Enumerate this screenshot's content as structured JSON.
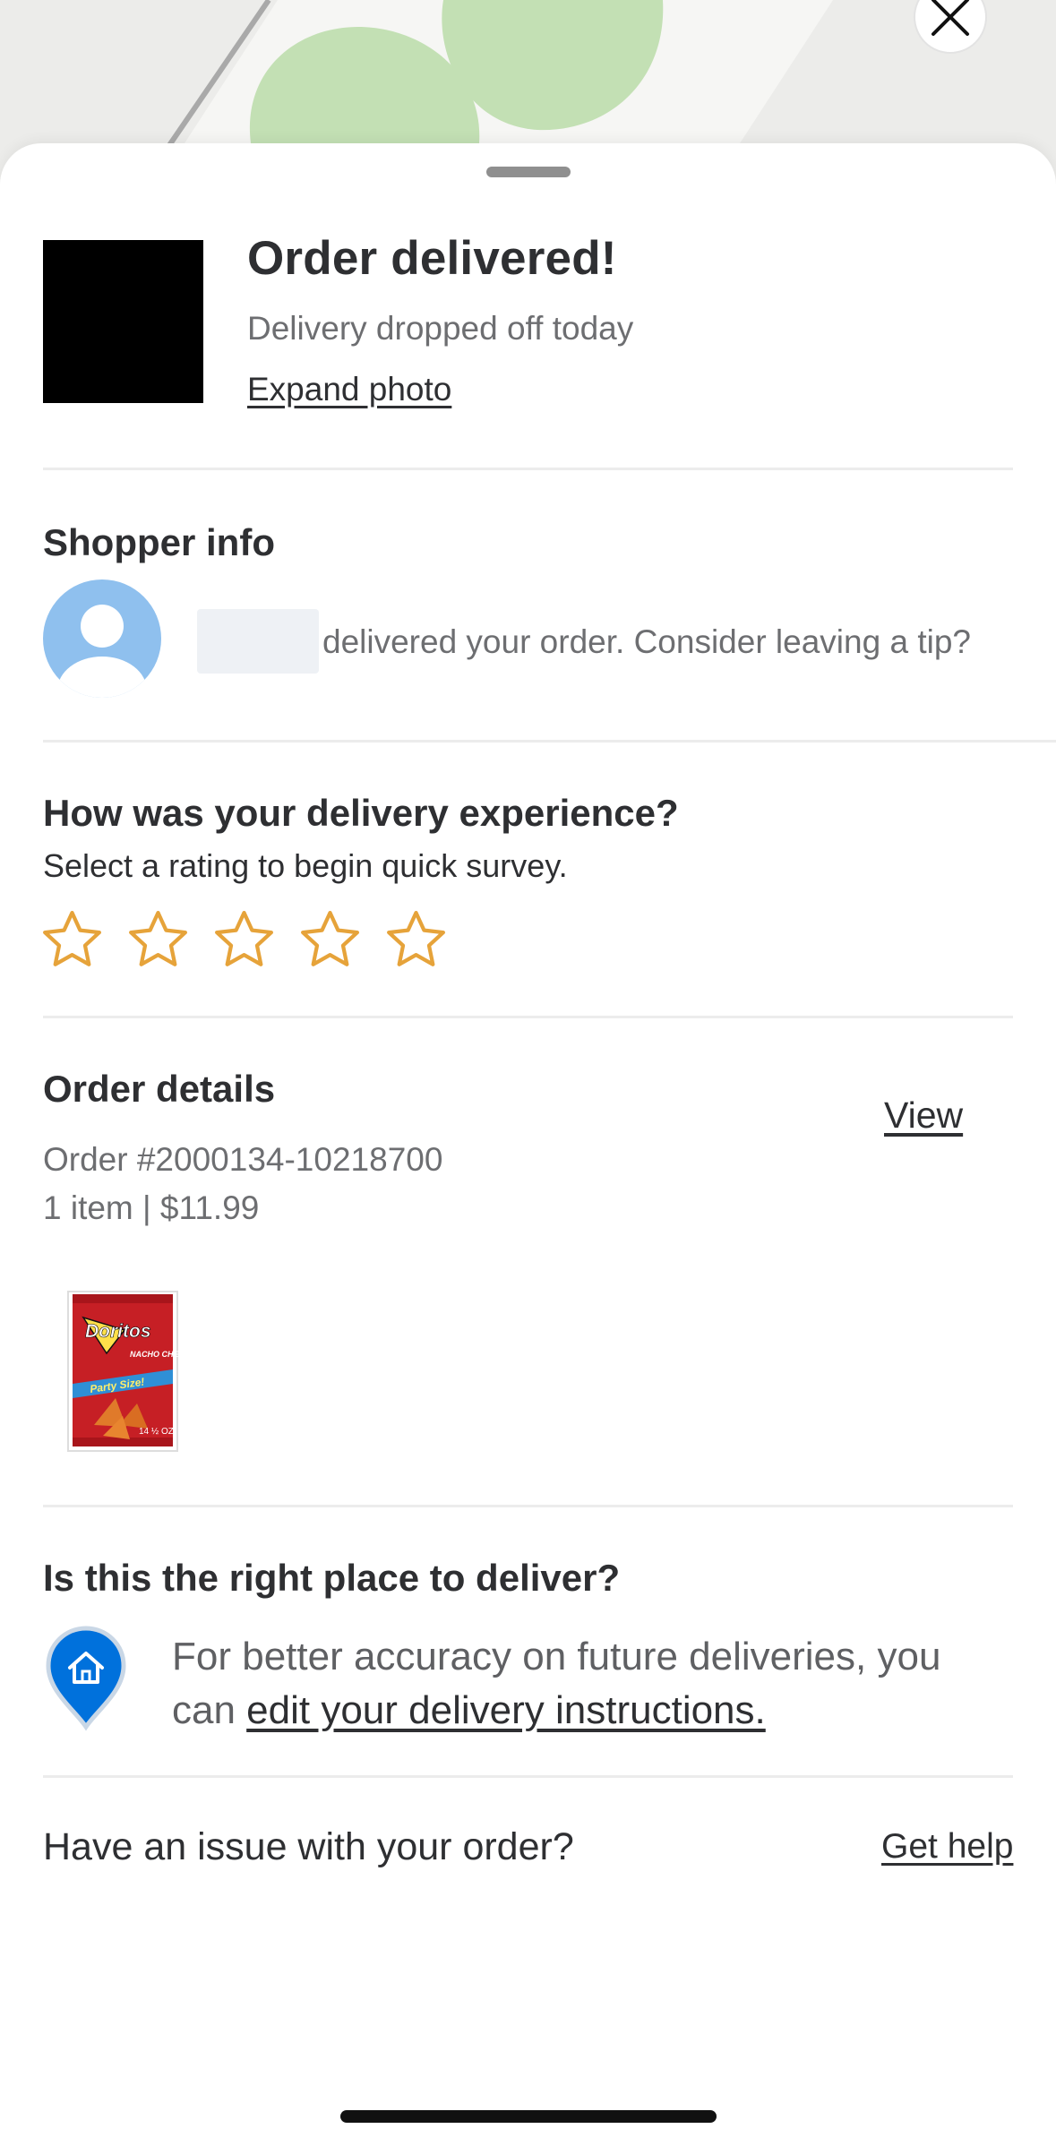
{
  "header": {
    "title": "Order delivered!",
    "subtitle": "Delivery dropped off today",
    "expand_photo": "Expand photo"
  },
  "shopper": {
    "heading": "Shopper info",
    "message": "delivered your order. Consider leaving a tip?"
  },
  "rating": {
    "heading": "How was your delivery experience?",
    "prompt": "Select a rating to begin quick survey.",
    "max_stars": 5,
    "selected": 0
  },
  "order": {
    "heading": "Order details",
    "view_label": "View",
    "number": "Order #2000134-10218700",
    "summary": "1 item | $11.99",
    "item": {
      "brand": "Doritos",
      "flavor": "NACHO CHEESE",
      "size_badge": "Party Size!",
      "weight": "14 ½ OZ"
    }
  },
  "location": {
    "heading": "Is this the right place to deliver?",
    "message_line1": "For better accuracy on future deliveries, you",
    "message_prefix": "can ",
    "link": "edit your delivery instructions."
  },
  "help": {
    "question": "Have an issue with your order?",
    "link": "Get help"
  },
  "colors": {
    "star_outline": "#e6a33a",
    "pin_blue": "#0071dc",
    "avatar_blue": "#8fc0ee",
    "map_green": "#c3e0b4",
    "text_dark": "#2e2f32",
    "text_grey": "#6d6e71"
  },
  "icons": {
    "close": "close-icon",
    "star": "star-icon",
    "pin": "home-pin-icon"
  }
}
